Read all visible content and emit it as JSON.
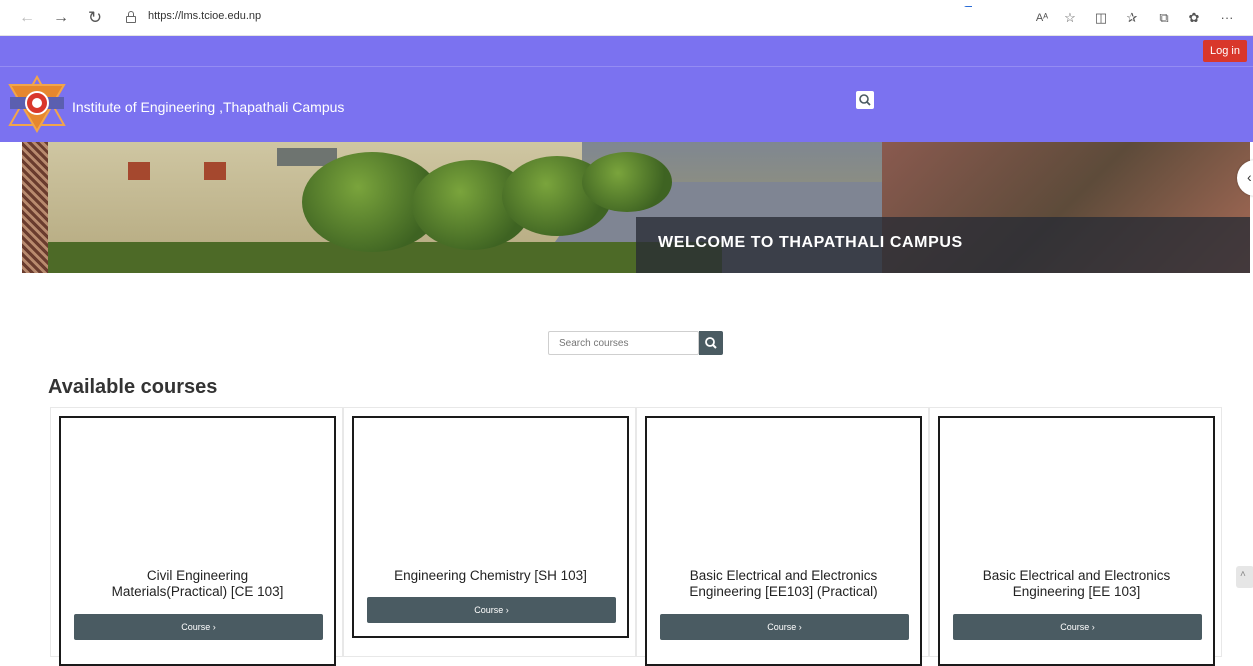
{
  "browser": {
    "url": "https://lms.tcioe.edu.np",
    "icons": [
      "back-icon",
      "forward-icon",
      "reload-icon",
      "lock-icon",
      "read-aloud-icon",
      "favorite-icon",
      "split-screen-icon",
      "favorites-icon",
      "collections-icon",
      "extensions-icon",
      "more-icon"
    ]
  },
  "topbar": {
    "login_label": "Log in"
  },
  "header": {
    "site_title": "Institute of Engineering ,Thapathali Campus"
  },
  "banner": {
    "caption": "WELCOME TO THAPATHALI CAMPUS"
  },
  "search": {
    "placeholder": "Search courses"
  },
  "courses_section": {
    "title": "Available courses"
  },
  "courses": [
    {
      "title_line1": "Civil Engineering",
      "title_line2": "Materials(Practical) [CE 103]",
      "button_label": "Course ›"
    },
    {
      "title_line1": "Engineering Chemistry [SH 103]",
      "title_line2": "",
      "button_label": "Course ›"
    },
    {
      "title_line1": "Basic Electrical and Electronics",
      "title_line2": "Engineering [EE103] (Practical)",
      "button_label": "Course ›"
    },
    {
      "title_line1": "Basic Electrical and Electronics",
      "title_line2": "Engineering [EE 103]",
      "button_label": "Course ›"
    }
  ],
  "colors": {
    "navbar": "#7b72f0",
    "login": "#d9372b",
    "button": "#4a5b62"
  }
}
